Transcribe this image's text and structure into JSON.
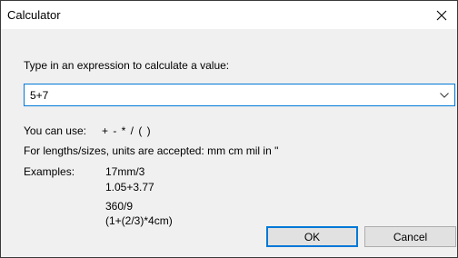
{
  "window": {
    "title": "Calculator"
  },
  "prompt": "Type in an expression to calculate a value:",
  "expression": {
    "value": "5+7"
  },
  "help": {
    "can_use_label": "You can use:",
    "operators": "+ - * / ( )",
    "units_line": "For lengths/sizes, units are accepted: mm cm mil in \"",
    "examples_label": "Examples:",
    "examples": [
      "17mm/3",
      "1.05+3.77",
      "360/9",
      "(1+(2/3)*4cm)"
    ]
  },
  "buttons": {
    "ok": "OK",
    "cancel": "Cancel"
  },
  "icons": {
    "close": "close-icon",
    "dropdown": "chevron-down-icon"
  },
  "colors": {
    "focus_accent": "#0078d7"
  }
}
